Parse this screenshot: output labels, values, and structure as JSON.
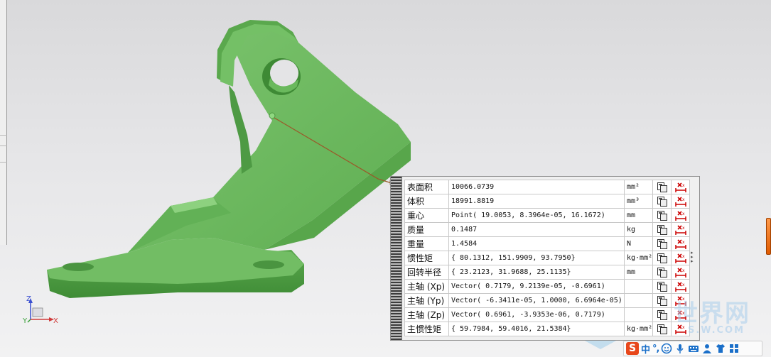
{
  "properties": [
    {
      "label": "表面积",
      "value": "10066.0739",
      "unit": "mm²"
    },
    {
      "label": "体积",
      "value": "18991.8819",
      "unit": "mm³"
    },
    {
      "label": "重心",
      "value": "Point( 19.0053, 8.3964e-05, 16.1672)",
      "unit": "mm"
    },
    {
      "label": "质量",
      "value": "0.1487",
      "unit": "kg"
    },
    {
      "label": "重量",
      "value": "1.4584",
      "unit": "N"
    },
    {
      "label": "惯性矩",
      "value": "{ 80.1312, 151.9909, 93.7950}",
      "unit": "kg·mm²"
    },
    {
      "label": "回转半径",
      "value": "{ 23.2123, 31.9688, 25.1135}",
      "unit": "mm"
    },
    {
      "label": "主轴 (Xp)",
      "value": "Vector( 0.7179, 9.2139e-05, -0.6961)",
      "unit": ""
    },
    {
      "label": "主轴 (Yp)",
      "value": "Vector( -6.3411e-05, 1.0000, 6.6964e-05)",
      "unit": ""
    },
    {
      "label": "主轴 (Zp)",
      "value": "Vector( 0.6961, -3.9353e-06, 0.7179)",
      "unit": ""
    },
    {
      "label": "主惯性矩",
      "value": "{ 59.7984, 59.4016, 21.5384}",
      "unit": "kg·mm²"
    }
  ],
  "triad": {
    "z": "Z",
    "y": "Y",
    "x": "X"
  },
  "watermark": {
    "text": "世界网",
    "sub": "S.W.COM"
  },
  "ime": {
    "logo": "S",
    "lang": "中",
    "punct": "°,"
  },
  "colors": {
    "part_green": "#67b85a",
    "part_dark": "#4e9a44",
    "part_light": "#86cc78",
    "leader_line": "#9a5a2a",
    "ime_logo": "#e8471b",
    "ime_blue": "#1a6fc9"
  },
  "icons": [
    "copy-icon",
    "measure-delete-icon",
    "ime-smiley-icon",
    "ime-mic-icon",
    "ime-keyboard-icon",
    "ime-user-icon",
    "ime-shirt-icon",
    "ime-grid-icon"
  ]
}
